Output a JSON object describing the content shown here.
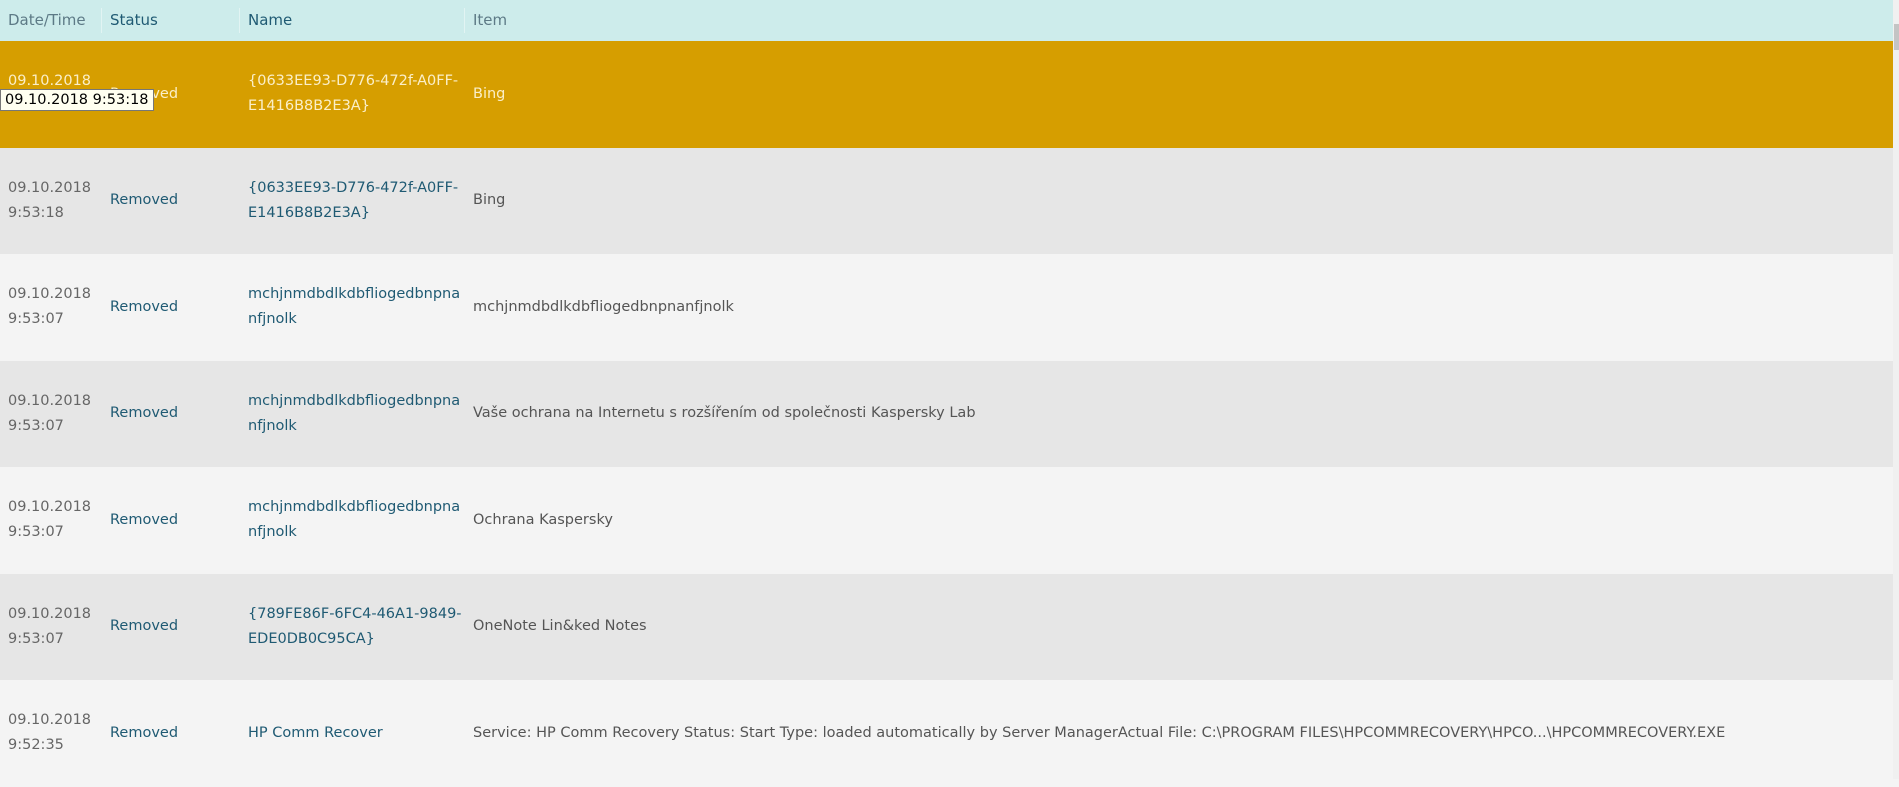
{
  "columns": [
    "Date/Time",
    "Status",
    "Name",
    "Item"
  ],
  "tooltip": "09.10.2018 9:53:18",
  "colors": {
    "header": "#cdeceb",
    "selected": "#d69e00",
    "row_even": "#e6e6e6",
    "row_odd": "#f4f4f4",
    "link": "#1f5a73"
  },
  "rows": [
    {
      "date": "09.10.2018",
      "time": "9:53:18",
      "status": "Removed",
      "name": "{0633EE93-D776-472f-A0FF-E1416B8B2E3A}",
      "item": "Bing",
      "selected": true
    },
    {
      "date": "09.10.2018",
      "time": "9:53:18",
      "status": "Removed",
      "name": "{0633EE93-D776-472f-A0FF-E1416B8B2E3A}",
      "item": "Bing"
    },
    {
      "date": "09.10.2018",
      "time": "9:53:07",
      "status": "Removed",
      "name": "mchjnmdbdlkdbfliogedbnpnanfjnolk",
      "item": "mchjnmdbdlkdbfliogedbnpnanfjnolk"
    },
    {
      "date": "09.10.2018",
      "time": "9:53:07",
      "status": "Removed",
      "name": "mchjnmdbdlkdbfliogedbnpnanfjnolk",
      "item": "Vaše ochrana na Internetu s rozšířením od společnosti Kaspersky Lab"
    },
    {
      "date": "09.10.2018",
      "time": "9:53:07",
      "status": "Removed",
      "name": "mchjnmdbdlkdbfliogedbnpnanfjnolk",
      "item": "Ochrana Kaspersky"
    },
    {
      "date": "09.10.2018",
      "time": "9:53:07",
      "status": "Removed",
      "name": "{789FE86F-6FC4-46A1-9849-EDE0DB0C95CA}",
      "item": "OneNote Lin&ked Notes"
    },
    {
      "date": "09.10.2018",
      "time": "9:52:35",
      "status": "Removed",
      "name": "HP Comm Recover",
      "item": "Service: HP Comm Recovery Status: Start Type: loaded automatically by Server ManagerActual File: C:\\PROGRAM FILES\\HPCOMMRECOVERY\\HPCO...\\HPCOMMRECOVERY.EXE"
    }
  ]
}
